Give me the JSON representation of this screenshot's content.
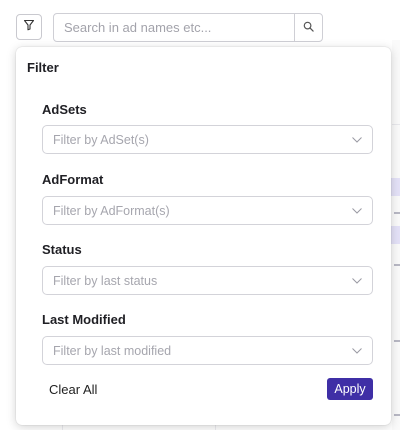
{
  "toolbar": {
    "filter_icon": "filter-funnel-icon",
    "search": {
      "placeholder": "Search in ad names etc...",
      "value": "",
      "icon": "search-icon"
    }
  },
  "filter_popover": {
    "title": "Filter",
    "groups": [
      {
        "label": "AdSets",
        "placeholder": "Filter by AdSet(s)"
      },
      {
        "label": "AdFormat",
        "placeholder": "Filter by AdFormat(s)"
      },
      {
        "label": "Status",
        "placeholder": "Filter by last status"
      },
      {
        "label": "Last Modified",
        "placeholder": "Filter by last modified"
      }
    ],
    "clear_all_label": "Clear All",
    "apply_label": "Apply"
  },
  "colors": {
    "accent": "#3f2fa6",
    "border": "#d3d3d9",
    "placeholder": "#a6a6ae"
  }
}
